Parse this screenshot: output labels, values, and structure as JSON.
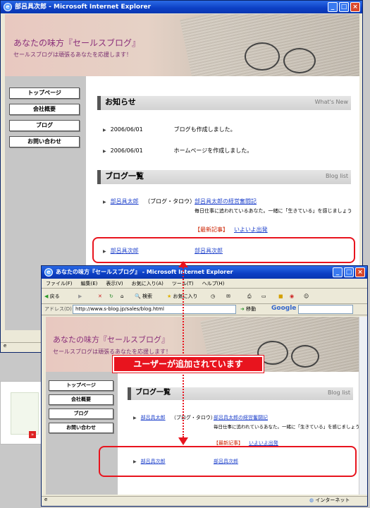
{
  "back_window": {
    "title": "部呂具次郎 - Microsoft Internet Explorer",
    "banner_title": "あなたの味方『セールスブログ』",
    "banner_sub": "セールスブログは頑張るあなたを応援します！",
    "nav": [
      "トップページ",
      "会社概要",
      "ブログ",
      "お問い合わせ"
    ],
    "news_header": "お知らせ",
    "news_header_en": "What's New",
    "news": [
      {
        "date": "2006/06/01",
        "text": "ブログも作成しました。"
      },
      {
        "date": "2006/06/01",
        "text": "ホームページを作成しました。"
      }
    ],
    "blog_header": "ブログ一覧",
    "blog_header_en": "Blog list",
    "blog_rows": [
      {
        "user": "部呂具太郎",
        "nick": "（ブログ・タロウ）",
        "title": "部呂具太郎の経営奮闘記",
        "desc": "毎日仕事に追われているあなた。一緒に「生きている」を感じましょう",
        "tag": "【最新記事】",
        "latest": "いよいよ出発"
      },
      {
        "user": "部呂具次郎",
        "nick": "",
        "title": "部呂具次郎",
        "desc": "",
        "tag": "",
        "latest": ""
      }
    ]
  },
  "front_window": {
    "title": "あなたの味方『セールスブログ』 - Microsoft Internet Explorer",
    "menu": [
      "ファイル(F)",
      "編集(E)",
      "表示(V)",
      "お気に入り(A)",
      "ツール(T)",
      "ヘルプ(H)"
    ],
    "toolbar": {
      "back": "戻る",
      "search": "検索",
      "favorites": "お気に入り"
    },
    "address_label": "アドレス(D)",
    "address_value": "http://www.s-blog.jp/sales/blog.html",
    "go_label": "移動",
    "google_label": "Google",
    "banner_title": "あなたの味方『セールスブログ』",
    "banner_sub": "セールスブログは頑張るあなたを応援します！",
    "nav": [
      "トップページ",
      "会社概要",
      "ブログ",
      "お問い合わせ"
    ],
    "blog_header": "ブログ一覧",
    "blog_header_en": "Blog list",
    "blog_rows": [
      {
        "user": "部呂具太郎",
        "nick": "（ブログ・タロウ）",
        "title": "部呂具太郎の経営奮闘記",
        "desc": "毎日仕事に追われているあなた。一緒に「生きている」を感じましょう",
        "tag": "【最新記事】",
        "latest": "いよいよ出発"
      },
      {
        "user": "部呂具次郎",
        "nick": "",
        "title": "部呂具次郎"
      }
    ],
    "status_zone": "インターネット"
  },
  "callout": "ユーザーが追加されています",
  "colors": {
    "highlight": "#e8141e",
    "titlebar": "#0c3fc4",
    "link": "#2244cc"
  }
}
